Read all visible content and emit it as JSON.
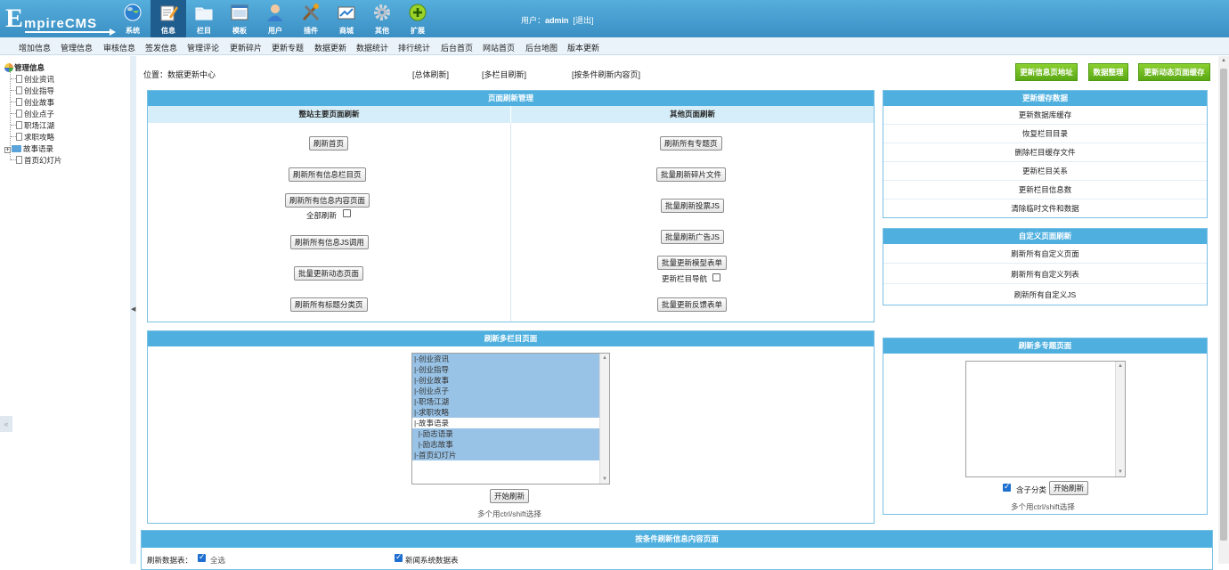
{
  "header": {
    "logo_initial": "E",
    "logo_rest": "mpireCMS",
    "nav": [
      {
        "label": "系统",
        "icon": "globe-icon",
        "active": false
      },
      {
        "label": "信息",
        "icon": "edit-icon",
        "active": true
      },
      {
        "label": "栏目",
        "icon": "folder-icon",
        "active": false
      },
      {
        "label": "模板",
        "icon": "template-icon",
        "active": false
      },
      {
        "label": "用户",
        "icon": "user-icon",
        "active": false
      },
      {
        "label": "插件",
        "icon": "tools-icon",
        "active": false
      },
      {
        "label": "商城",
        "icon": "shop-icon",
        "active": false
      },
      {
        "label": "其他",
        "icon": "gear-icon",
        "active": false
      },
      {
        "label": "扩展",
        "icon": "plus-icon",
        "active": false
      }
    ],
    "user_label": "用户：",
    "username": "admin",
    "logout": "[退出]"
  },
  "subnav": [
    "增加信息",
    "管理信息",
    "审核信息",
    "签发信息",
    "管理评论",
    "更新碎片",
    "更新专题",
    "数据更新",
    "数据统计",
    "排行统计",
    "后台首页",
    "网站首页",
    "后台地图",
    "版本更新"
  ],
  "tree": {
    "root": "管理信息",
    "items": [
      "创业资讯",
      "创业指导",
      "创业故事",
      "创业点子",
      "职场江湖",
      "求职攻略",
      "故事语录",
      "首页幻灯片"
    ]
  },
  "main": {
    "position_label": "位置：",
    "position_link": "数据更新中心",
    "links": [
      "[总体刷新]",
      "[多栏目刷新]",
      "[按条件刷新内容页]"
    ],
    "top_buttons": [
      "更新信息页地址",
      "数据整理",
      "更新动态页面缓存"
    ],
    "page_refresh": {
      "title": "页面刷新管理",
      "left_sub": "整站主要页面刷新",
      "right_sub": "其他页面刷新",
      "left_buttons": [
        "刷新首页",
        "刷新所有信息栏目页",
        "刷新所有信息内容页面",
        "刷新所有信息JS调用",
        "批量更新动态页面",
        "刷新所有标题分类页"
      ],
      "all_refresh_label": "全部刷新",
      "right_buttons": [
        "刷新所有专题页",
        "批量刷新碎片文件",
        "批量刷新投票JS",
        "批量刷新广告JS",
        "批量更新模型表单",
        "批量更新反馈表单"
      ],
      "update_nav_label": "更新栏目导航"
    },
    "cache": {
      "title": "更新缓存数据",
      "items": [
        "更新数据库缓存",
        "恢复栏目目录",
        "删除栏目缓存文件",
        "更新栏目关系",
        "更新栏目信息数",
        "清除临时文件和数据"
      ]
    },
    "custom": {
      "title": "自定义页面刷新",
      "items": [
        "刷新所有自定义页面",
        "刷新所有自定义列表",
        "刷新所有自定义JS"
      ]
    },
    "multi_column": {
      "title": "刷新多栏目页面",
      "options": [
        {
          "label": "|-创业资讯",
          "selected": true
        },
        {
          "label": "|-创业指导",
          "selected": true
        },
        {
          "label": "|-创业故事",
          "selected": true
        },
        {
          "label": "|-创业点子",
          "selected": true
        },
        {
          "label": "|-职场江湖",
          "selected": true
        },
        {
          "label": "|-求职攻略",
          "selected": true
        },
        {
          "label": "|-故事语录",
          "selected": false
        },
        {
          "label": "  |-励志语录",
          "selected": true
        },
        {
          "label": "  |-励志故事",
          "selected": true
        },
        {
          "label": "|-首页幻灯片",
          "selected": true
        }
      ],
      "start_button": "开始刷新",
      "hint": "多个用ctrl/shift选择"
    },
    "multi_topic": {
      "title": "刷新多专题页面",
      "include_sub_label": "含子分类",
      "start_button": "开始刷新",
      "hint": "多个用ctrl/shift选择"
    },
    "conditional": {
      "title": "按条件刷新信息内容页面",
      "table_label": "刷新数据表：",
      "all_label": "全选",
      "news_label": "新闻系统数据表"
    }
  }
}
